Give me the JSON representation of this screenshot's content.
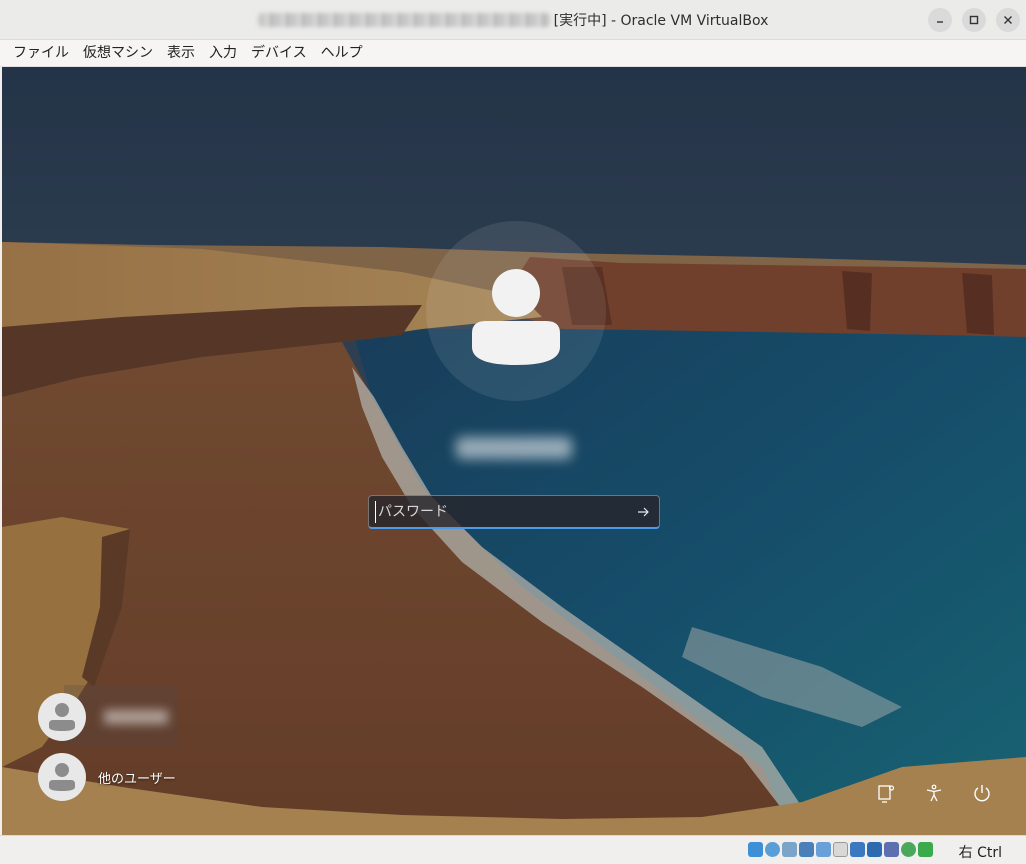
{
  "window": {
    "title_suffix": "[実行中] - Oracle VM VirtualBox"
  },
  "menubar": {
    "items": [
      "ファイル",
      "仮想マシン",
      "表示",
      "入力",
      "デバイス",
      "ヘルプ"
    ]
  },
  "login": {
    "password_placeholder": "パスワード",
    "other_user_label": "他のユーザー"
  },
  "statusbar": {
    "host_key": "右 Ctrl",
    "icon_names": [
      "hard-disk-icon",
      "optical-drive-icon",
      "audio-icon",
      "network-icon",
      "usb-icon",
      "shared-folders-icon",
      "display-icon",
      "recording-icon",
      "cpu-icon",
      "mouse-integration-icon",
      "keyboard-icon",
      "host-key-icon"
    ]
  }
}
